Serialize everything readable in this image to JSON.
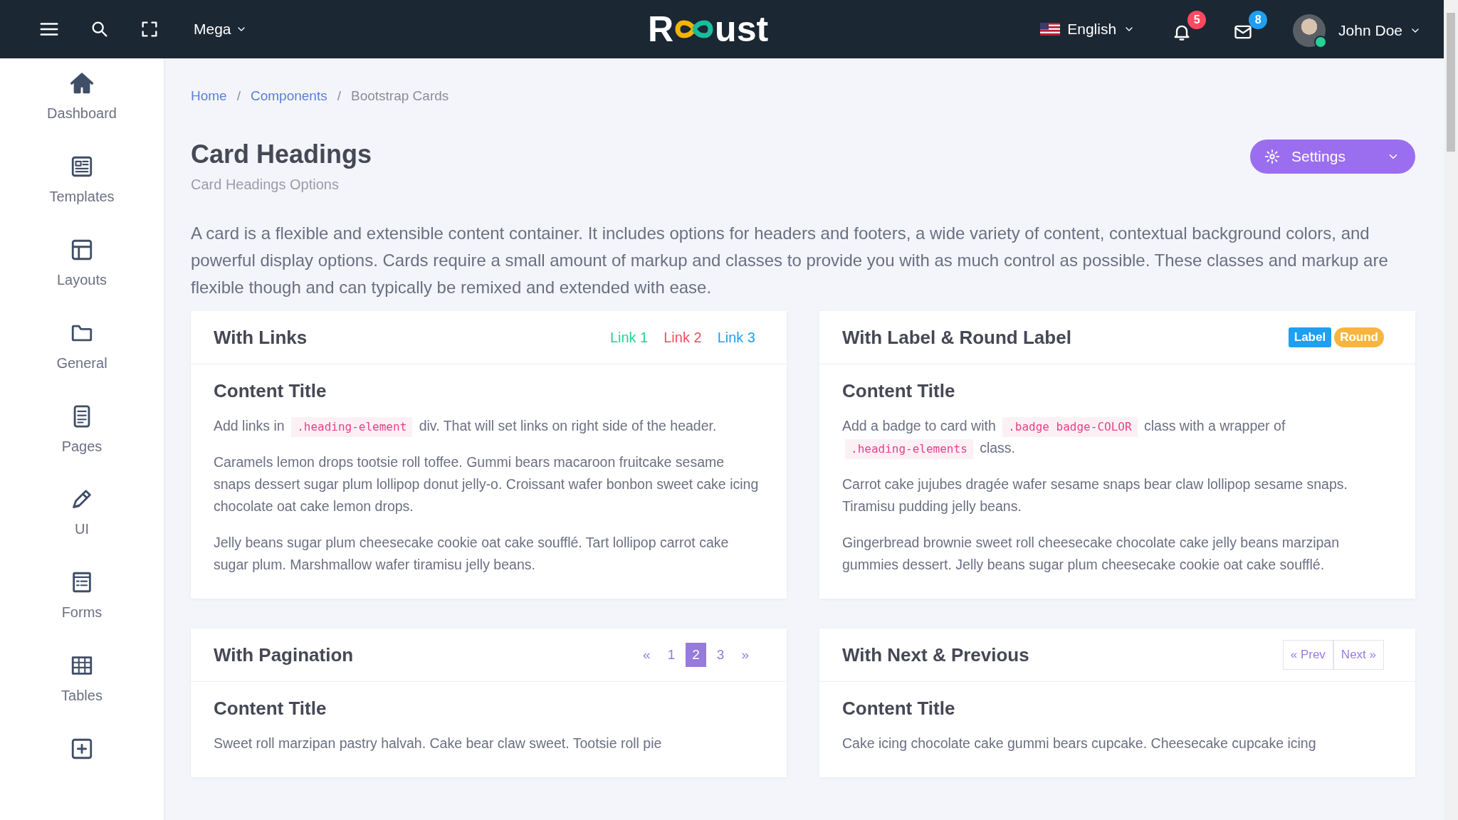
{
  "topbar": {
    "mega_menu": "Mega",
    "logo_start": "R",
    "logo_end": "ust",
    "language": "English",
    "notifications": "5",
    "messages": "8",
    "user": "John Doe"
  },
  "sidebar": {
    "items": [
      {
        "label": "Dashboard"
      },
      {
        "label": "Templates"
      },
      {
        "label": "Layouts"
      },
      {
        "label": "General"
      },
      {
        "label": "Pages"
      },
      {
        "label": "UI"
      },
      {
        "label": "Forms"
      },
      {
        "label": "Tables"
      }
    ]
  },
  "breadcrumb": [
    {
      "label": "Home",
      "kind": "link"
    },
    {
      "label": "/",
      "kind": "separator"
    },
    {
      "label": "Components",
      "kind": "link"
    },
    {
      "label": "/",
      "kind": "separator"
    },
    {
      "label": "Bootstrap Cards",
      "kind": "current"
    }
  ],
  "page": {
    "title": "Card Headings",
    "subtitle": "Card Headings Options",
    "settings_button": "Settings",
    "intro": "A card is a flexible and extensible content container. It includes options for headers and footers, a wide variety of content, contextual background colors, and powerful display options. Cards require a small amount of markup and classes to provide you with as much control as possible. These classes and markup are flexible though and can typically be remixed and extended with ease."
  },
  "cards": [
    {
      "title": "With Links",
      "header": {
        "kind": "links",
        "items": [
          {
            "label": "Link 1",
            "color": "#28d094"
          },
          {
            "label": "Link 2",
            "color": "#ff4961"
          },
          {
            "label": "Link 3",
            "color": "#1e9ff2"
          }
        ]
      },
      "content_title": "Content Title",
      "paragraphs": [
        [
          {
            "text": "Add links in "
          },
          {
            "text": ".heading-element",
            "code": true
          },
          {
            "text": " div. That will set links on right side of the header."
          }
        ],
        [
          {
            "text": "Caramels lemon drops tootsie roll toffee. Gummi bears macaroon fruitcake sesame snaps dessert sugar plum lollipop donut jelly-o. Croissant wafer bonbon sweet cake icing chocolate oat cake lemon drops."
          }
        ],
        [
          {
            "text": "Jelly beans sugar plum cheesecake cookie oat cake soufflé. Tart lollipop carrot cake sugar plum. Marshmallow wafer tiramisu jelly beans."
          }
        ]
      ]
    },
    {
      "title": "With Label & Round Label",
      "header": {
        "kind": "badges",
        "items": [
          {
            "label": "Label",
            "round": false,
            "color": "#1e9ff2"
          },
          {
            "label": "Round",
            "round": true,
            "color": "#f7b53f"
          }
        ]
      },
      "content_title": "Content Title",
      "paragraphs": [
        [
          {
            "text": "Add a badge to card with "
          },
          {
            "text": ".badge badge-COLOR",
            "code": true
          },
          {
            "text": " class with a wrapper of "
          },
          {
            "text": ".heading-elements",
            "code": true
          },
          {
            "text": " class."
          }
        ],
        [
          {
            "text": "Carrot cake jujubes dragée wafer sesame snaps bear claw lollipop sesame snaps. Tiramisu pudding jelly beans."
          }
        ],
        [
          {
            "text": "Gingerbread brownie sweet roll cheesecake chocolate cake jelly beans marzipan gummies dessert. Jelly beans sugar plum cheesecake cookie oat cake soufflé."
          }
        ]
      ]
    },
    {
      "title": "With Pagination",
      "header": {
        "kind": "pagination",
        "items": [
          {
            "label": "«",
            "selected": false
          },
          {
            "label": "1",
            "selected": false
          },
          {
            "label": "2",
            "selected": true
          },
          {
            "label": "3",
            "selected": false
          },
          {
            "label": "»",
            "selected": false
          }
        ]
      },
      "content_title": "Content Title",
      "paragraphs": [
        [
          {
            "text": "Sweet roll marzipan pastry halvah. Cake bear claw sweet. Tootsie roll pie"
          }
        ]
      ]
    },
    {
      "title": "With Next & Previous",
      "header": {
        "kind": "pager",
        "items": [
          {
            "label": "« Prev"
          },
          {
            "label": "Next »"
          }
        ]
      },
      "content_title": "Content Title",
      "paragraphs": [
        [
          {
            "text": "Cake icing chocolate cake gummi bears cupcake. Cheesecake cupcake icing"
          }
        ]
      ]
    }
  ]
}
